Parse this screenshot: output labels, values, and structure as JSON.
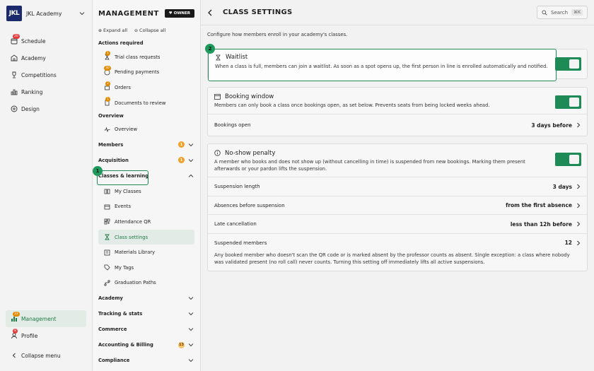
{
  "org": {
    "name": "JKL Academy",
    "logo_text": "JKL"
  },
  "rail": {
    "items": [
      {
        "label": "Schedule",
        "icon": "calendar-icon",
        "badge": "20"
      },
      {
        "label": "Academy",
        "icon": "building-icon"
      },
      {
        "label": "Competitions",
        "icon": "trophy-icon"
      },
      {
        "label": "Ranking",
        "icon": "chart-icon"
      },
      {
        "label": "Design",
        "icon": "palette-icon"
      }
    ],
    "management": {
      "label": "Management",
      "badge": "33"
    },
    "profile": {
      "label": "Profile",
      "badge": "8"
    },
    "collapse": "Collapse menu"
  },
  "panel": {
    "title": "MANAGEMENT",
    "owner_badge": "OWNER",
    "expand_all": "Expand all",
    "collapse_all": "Collapse all",
    "actions_required": "Actions required",
    "actions": [
      {
        "label": "Trial class requests",
        "badge": "1"
      },
      {
        "label": "Pending payments",
        "badge": "30"
      },
      {
        "label": "Orders",
        "badge": "2"
      },
      {
        "label": "Documents to review",
        "badge": "1"
      }
    ],
    "overview_section": "Overview",
    "overview_item": "Overview",
    "members": {
      "label": "Members",
      "badge": "1"
    },
    "acquisition": {
      "label": "Acquisition",
      "badge": "1"
    },
    "classes_learning": "Classes & learning",
    "classes_items": [
      "My Classes",
      "Events",
      "Attendance QR",
      "Class settings",
      "Materials Library",
      "My Tags",
      "Graduation Paths"
    ],
    "academy": "Academy",
    "tracking": "Tracking & stats",
    "commerce": "Commerce",
    "accounting": {
      "label": "Accounting & Billing",
      "badge": "13"
    },
    "compliance": "Compliance"
  },
  "main": {
    "title": "CLASS SETTINGS",
    "search": "Search",
    "search_kbd": "⌘K",
    "description": "Configure how members enroll in your academy's classes.",
    "waitlist": {
      "title": "Waitlist",
      "desc": "When a class is full, members can join a waitlist. As soon as a spot opens up, the first person in line is enrolled automatically and notified.",
      "enabled": true
    },
    "booking": {
      "title": "Booking window",
      "desc": "Members can only book a class once bookings open, as set below. Prevents seats from being locked weeks ahead.",
      "row_label": "Bookings open",
      "row_value": "3 days before",
      "enabled": true
    },
    "noshow": {
      "title": "No-show penalty",
      "desc": "A member who books and does not show up (without cancelling in time) is suspended from new bookings. Marking them present afterwards or your pardon lifts the suspension.",
      "rows": [
        {
          "label": "Suspension length",
          "value": "3 days"
        },
        {
          "label": "Absences before suspension",
          "value": "from the first absence"
        },
        {
          "label": "Late cancellation",
          "value": "less than 12h before"
        },
        {
          "label": "Suspended members",
          "value": "12"
        }
      ],
      "footer": "Any booked member who doesn't scan the QR code or is marked absent by the professor counts as absent. Single exception: a class where nobody was validated present (no roll call) never counts. Turning this setting off immediately lifts all active suspensions.",
      "enabled": true
    }
  },
  "callouts": [
    "1",
    "2"
  ],
  "colors": {
    "accent": "#1e8a55",
    "badge_red": "#e23b3b",
    "badge_orange": "#f0a028",
    "logo": "#1a2a6c"
  }
}
